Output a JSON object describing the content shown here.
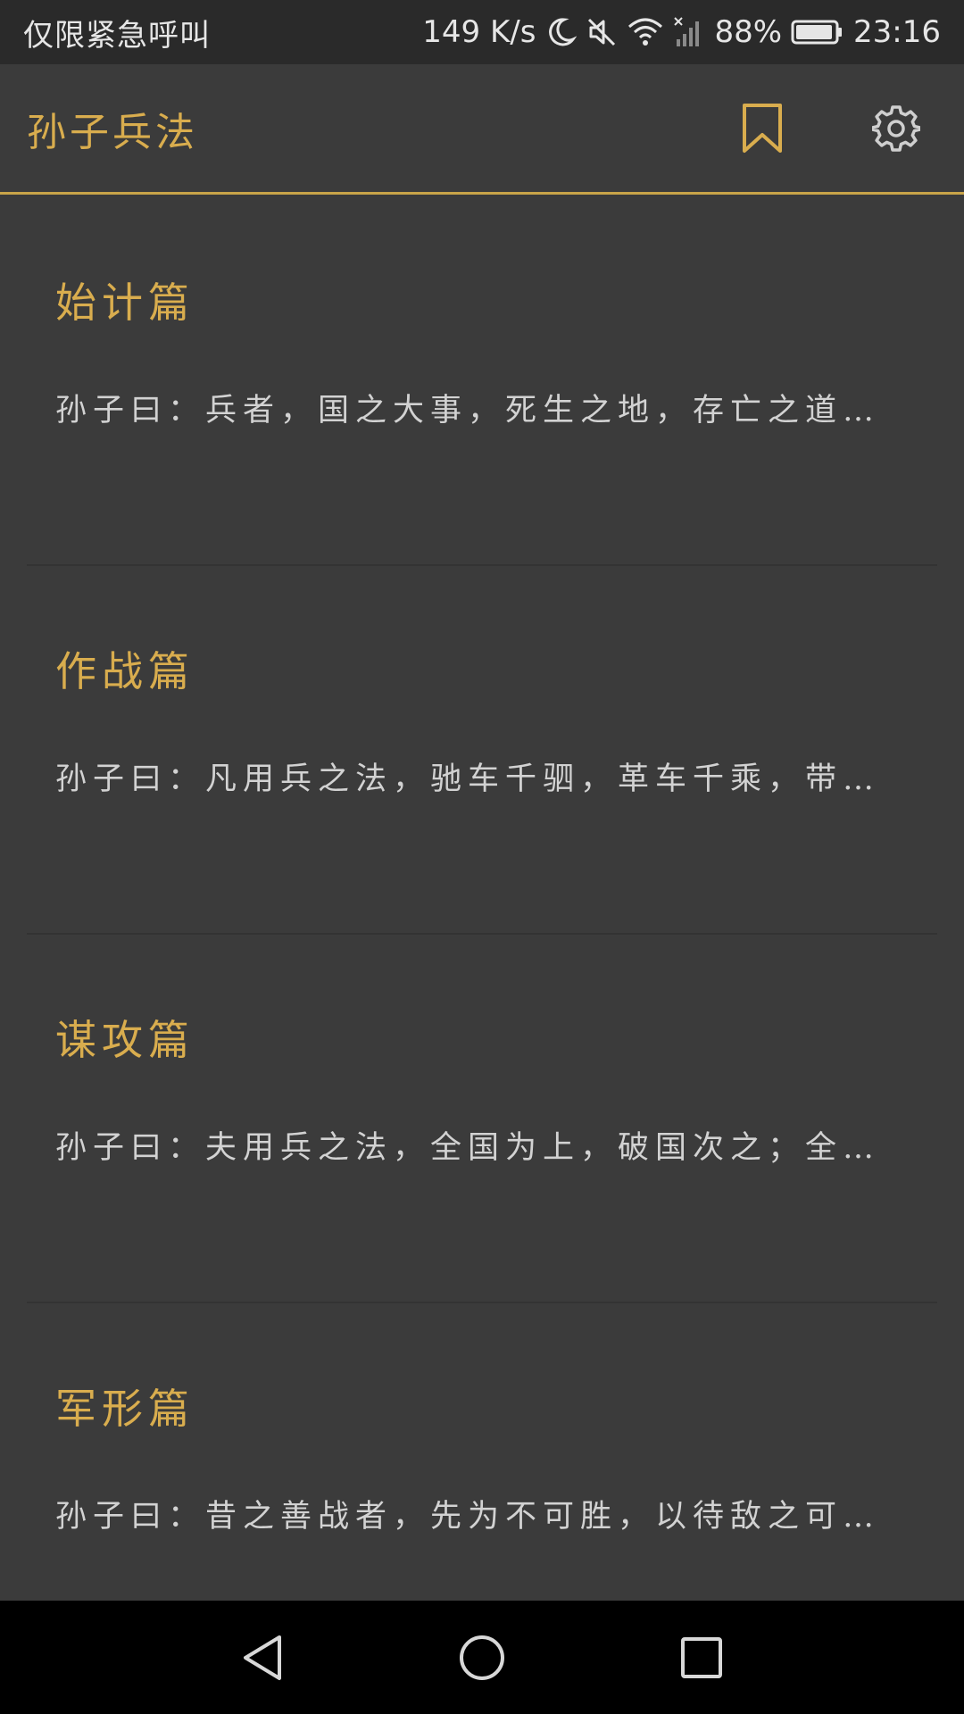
{
  "status_bar": {
    "carrier_text": "仅限紧急呼叫",
    "network_speed": "149 K/s",
    "battery_percent": "88%",
    "time": "23:16",
    "icons": [
      "moon-icon",
      "mute-icon",
      "wifi-icon",
      "signal-icon",
      "battery-icon"
    ]
  },
  "app_bar": {
    "title": "孙子兵法",
    "actions": [
      "bookmark-icon",
      "gear-icon"
    ]
  },
  "chapters": [
    {
      "title": "始计篇",
      "summary": "孙子曰：兵者，国之大事，死生之地，存亡之道…"
    },
    {
      "title": "作战篇",
      "summary": "孙子曰：凡用兵之法，驰车千驷，革车千乘，带…"
    },
    {
      "title": "谋攻篇",
      "summary": "孙子曰：夫用兵之法，全国为上，破国次之；全…"
    },
    {
      "title": "军形篇",
      "summary": "孙子曰：昔之善战者，先为不可胜，以待敌之可…"
    }
  ],
  "nav_bar": {
    "buttons": [
      "back-icon",
      "home-icon",
      "recents-icon"
    ]
  },
  "colors": {
    "accent": "#d9ad4e",
    "background": "#3b3b3b",
    "status_bar": "#2a2a2a",
    "nav_bar": "#000000"
  }
}
